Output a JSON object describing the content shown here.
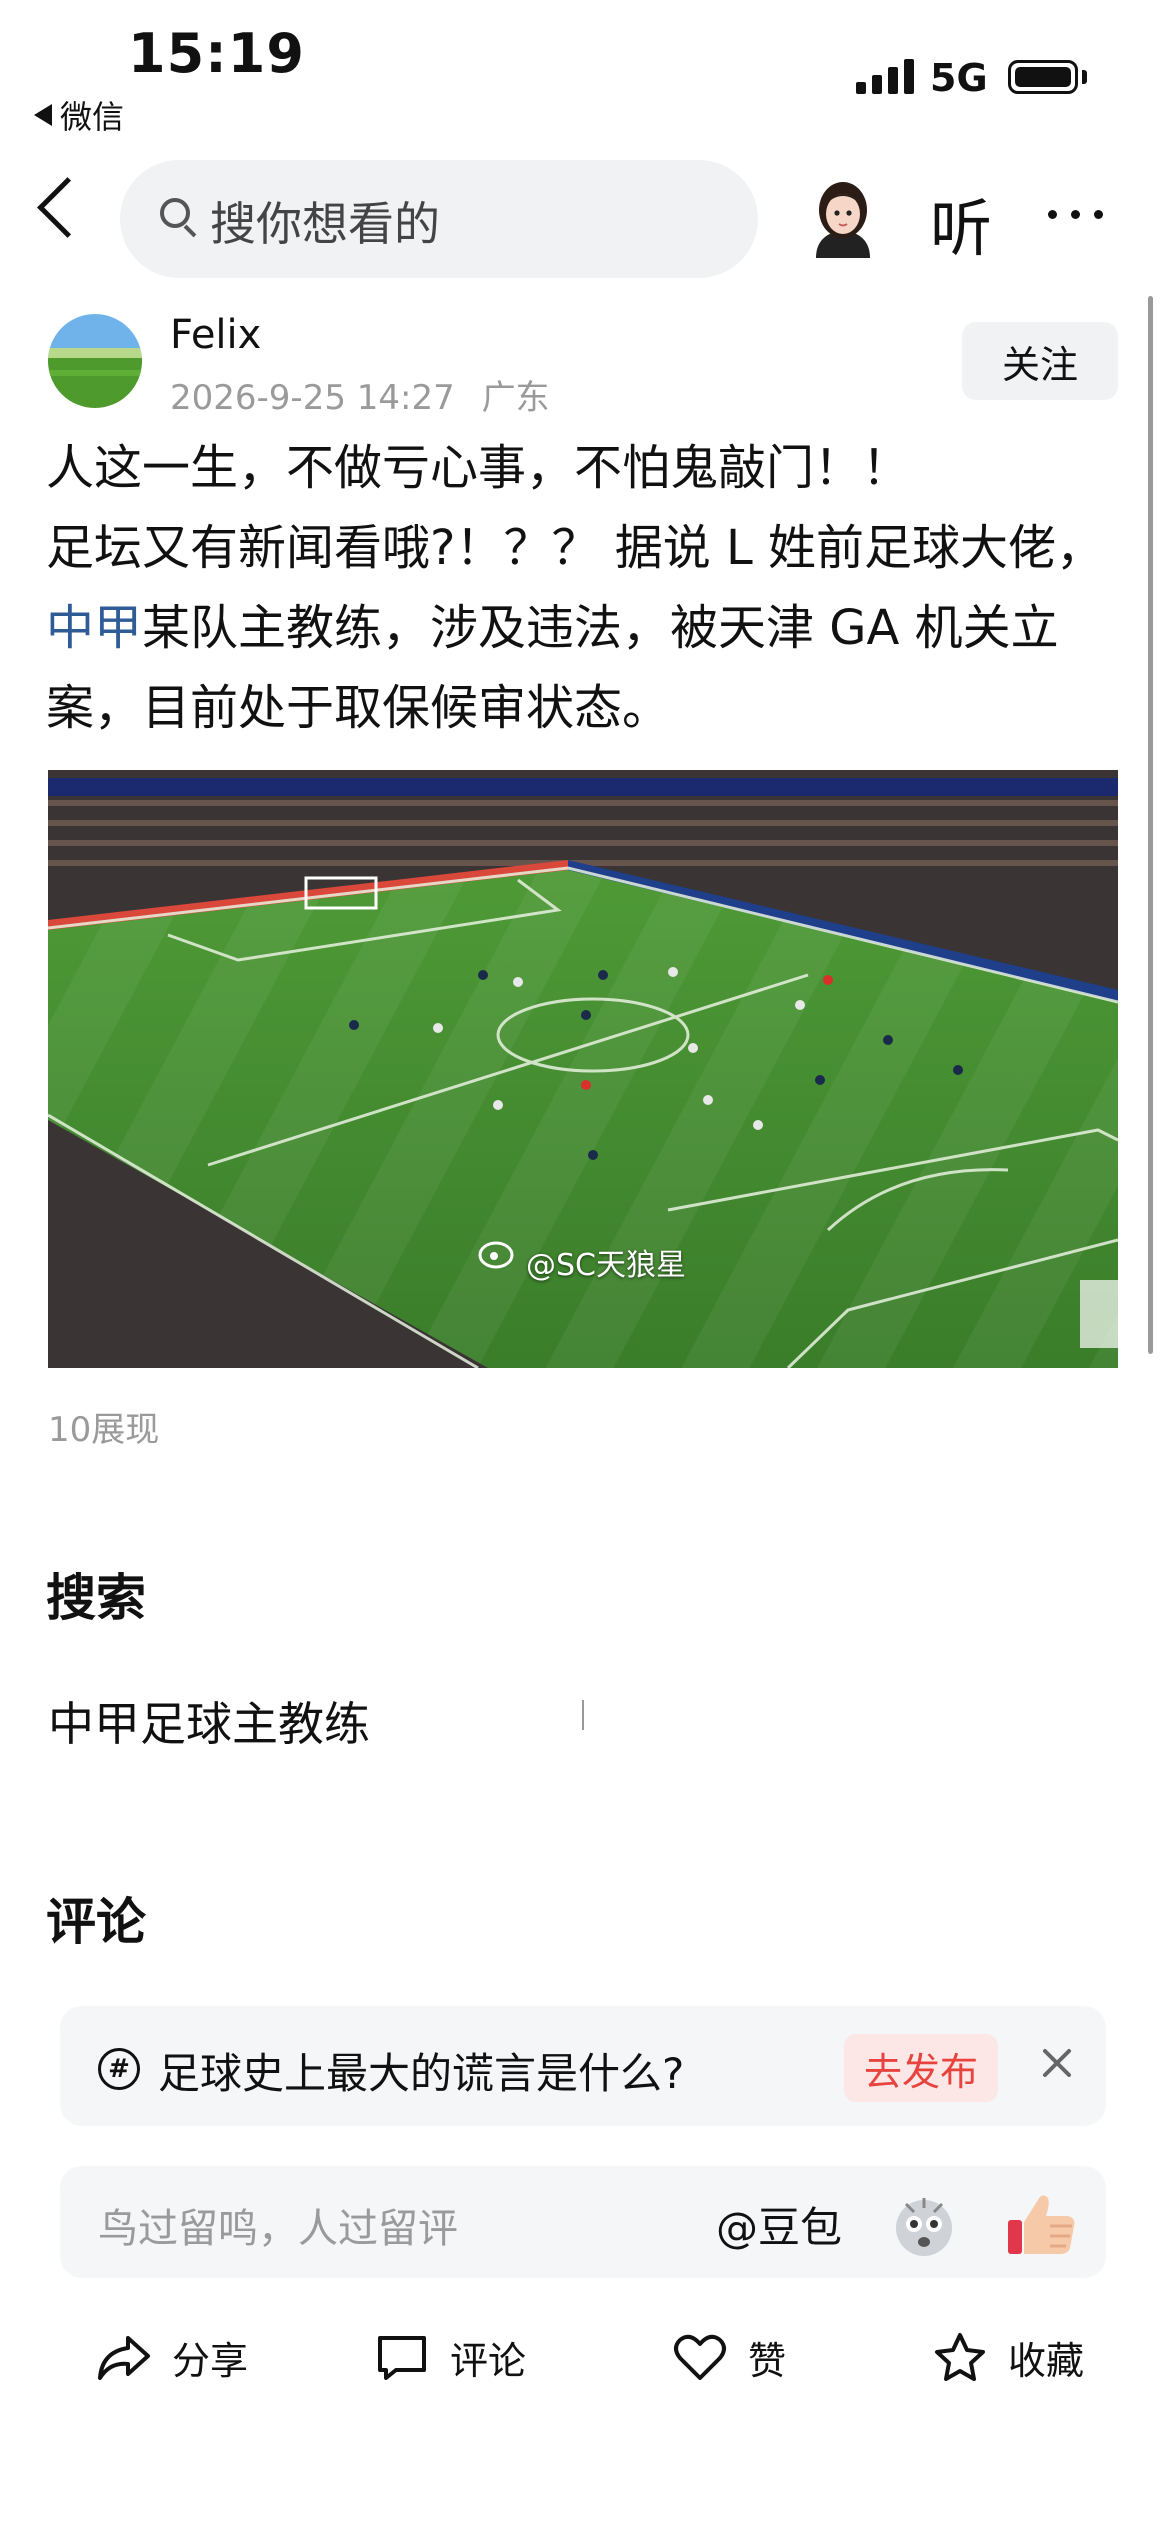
{
  "status_bar": {
    "time": "15:19",
    "back_app": "微信",
    "network": "5G"
  },
  "nav": {
    "search_placeholder": "搜你想看的",
    "listen_label": "听"
  },
  "post": {
    "username": "Felix",
    "datetime": "2026-9-25 14:27",
    "location": "广东",
    "follow_label": "关注",
    "lines": [
      "人这一生，不做亏心事，不怕鬼敲门！！",
      "足坛又有新闻看哦?！？？ 据说 L 姓前足球大佬，",
      "某队主教练，涉及违法，被天津 GA 机关立",
      "案，目前处于取保候审状态。"
    ],
    "link_text": "中甲",
    "image_watermark": "@SC天狼星",
    "views": "10展现"
  },
  "search_section": {
    "title": "搜索",
    "suggestion": "中甲足球主教练"
  },
  "comments_section": {
    "title": "评论",
    "topic_text": "足球史上最大的谎言是什么?",
    "publish_label": "去发布",
    "input_placeholder": "鸟过留鸣，人过留评",
    "mention_label": "@豆包"
  },
  "bottom_bar": {
    "share": "分享",
    "comment": "评论",
    "like": "赞",
    "favorite": "收藏"
  },
  "colors": {
    "link": "#2f5b96",
    "publish_red": "#e7433f",
    "pitch_green": "#3f8a2e",
    "muted": "#9a9a9a"
  },
  "icons": [
    "back-icon",
    "search-icon",
    "avatar-icon",
    "more-icon",
    "hashtag-icon",
    "close-icon",
    "shocked-emoji-icon",
    "thumbs-up-emoji-icon",
    "share-icon",
    "comment-icon",
    "heart-icon",
    "star-icon",
    "weibo-icon"
  ]
}
